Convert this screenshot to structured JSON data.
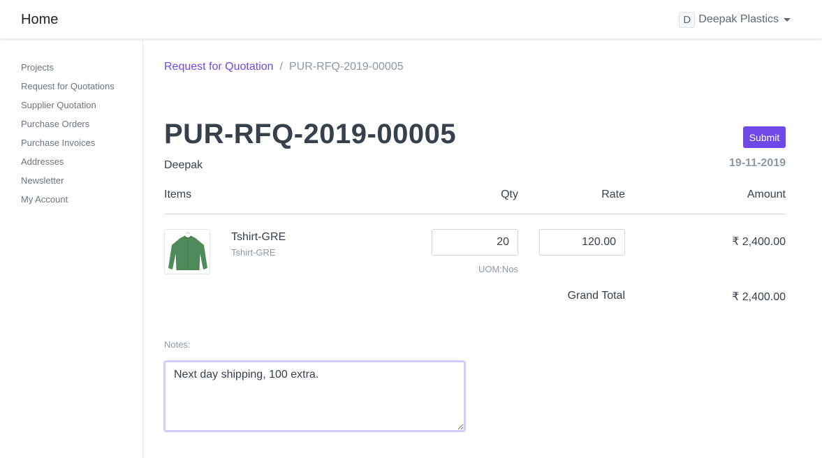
{
  "navbar": {
    "brand": "Home",
    "user": {
      "initial": "D",
      "name": "Deepak Plastics"
    }
  },
  "sidebar": {
    "items": [
      {
        "label": "Projects"
      },
      {
        "label": "Request for Quotations"
      },
      {
        "label": "Supplier Quotation"
      },
      {
        "label": "Purchase Orders"
      },
      {
        "label": "Purchase Invoices"
      },
      {
        "label": "Addresses"
      },
      {
        "label": "Newsletter"
      },
      {
        "label": "My Account"
      }
    ]
  },
  "breadcrumb": {
    "parent": "Request for Quotation",
    "separator": "/",
    "current": "PUR-RFQ-2019-00005"
  },
  "doc": {
    "title": "PUR-RFQ-2019-00005",
    "supplier": "Deepak",
    "date": "19-11-2019",
    "submit_label": "Submit"
  },
  "table": {
    "headers": {
      "items": "Items",
      "qty": "Qty",
      "rate": "Rate",
      "amount": "Amount"
    },
    "rows": [
      {
        "item_name": "Tshirt-GRE",
        "item_code": "Tshirt-GRE",
        "image_icon": "green-tshirt",
        "qty": "20",
        "rate": "120.00",
        "uom": "UOM:Nos",
        "amount": "₹ 2,400.00"
      }
    ],
    "grand_total_label": "Grand Total",
    "grand_total": "₹ 2,400.00"
  },
  "notes": {
    "label": "Notes:",
    "value": "Next day shipping, 100 extra."
  },
  "colors": {
    "primary": "#7048e8",
    "text": "#36414c",
    "muted": "#8d99a6",
    "notes_focus_border": "#d6ccfa"
  }
}
